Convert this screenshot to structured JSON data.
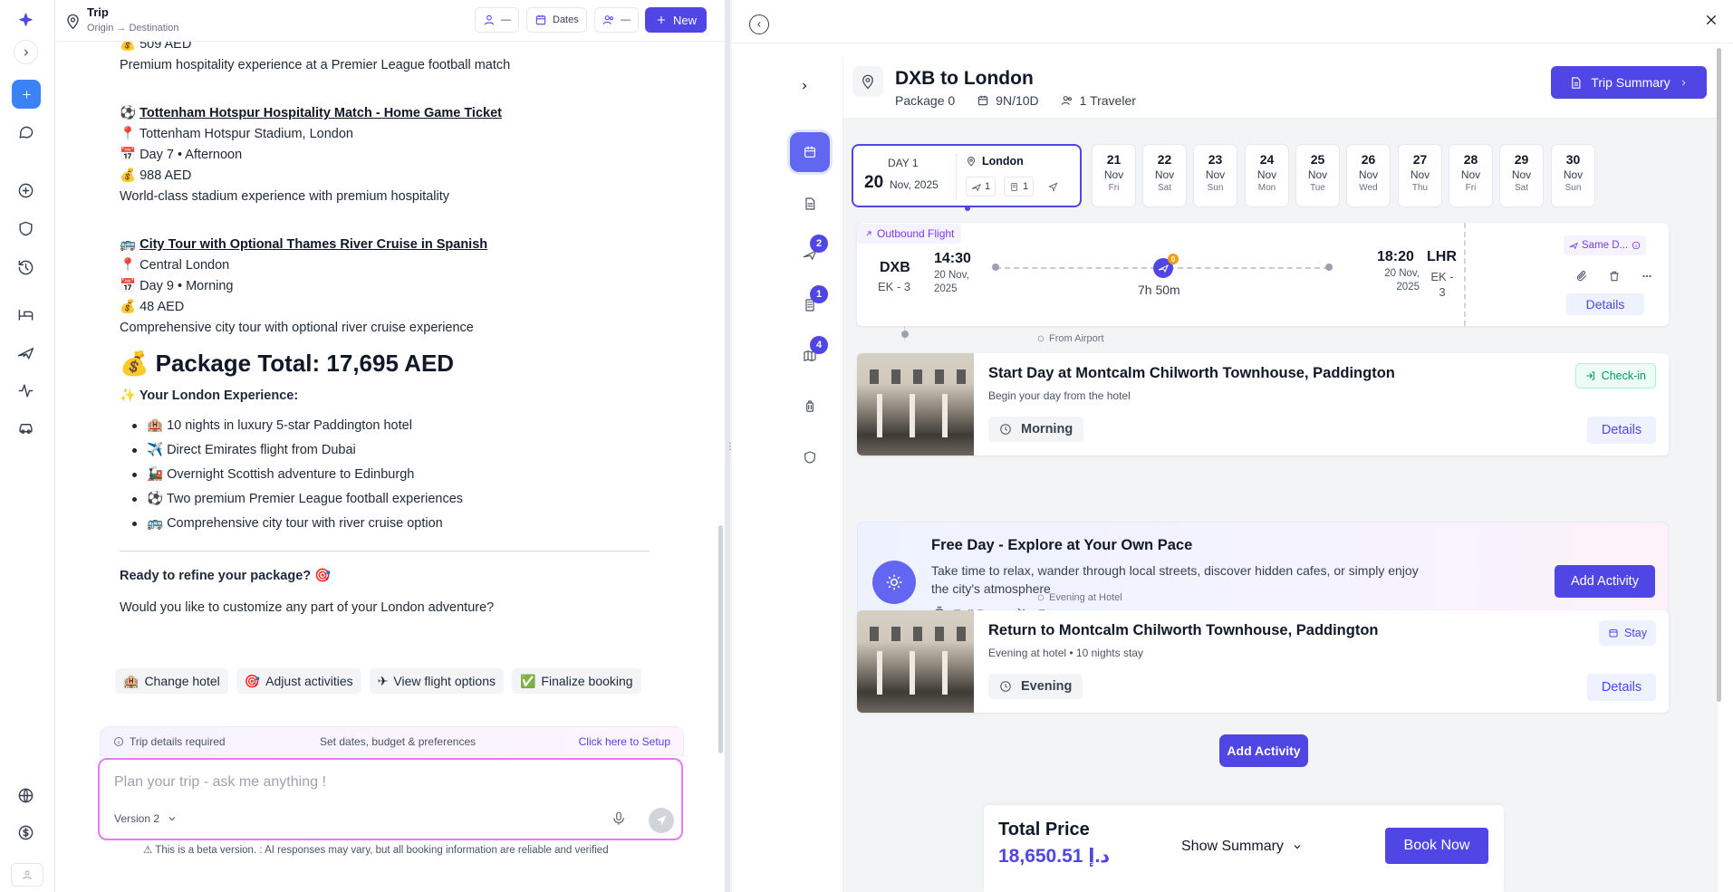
{
  "rail": {
    "icons": [
      "sparkle-logo-icon",
      "chevron-right-icon",
      "plus-icon",
      "chat-bubble-icon",
      "plus-circle-icon",
      "shield-icon",
      "history-icon",
      "bed-icon",
      "plane-icon",
      "activity-icon",
      "car-icon",
      "globe-icon",
      "dollar-icon",
      "user-icon"
    ]
  },
  "chat": {
    "header": {
      "title": "Trip",
      "subtitle": "Origin → Destination",
      "travelers_value": "—",
      "dates_label": "Dates",
      "group_value": "—",
      "new_label": "New"
    },
    "message": {
      "top_price": "💰 509 AED",
      "top_desc": "Premium hospitality experience at a Premier League football match",
      "items": [
        {
          "icon": "⚽",
          "title": "Tottenham Hotspur Hospitality Match - Home Game Ticket",
          "location": "📍 Tottenham Hotspur Stadium, London",
          "when": "📅 Day 7 • Afternoon",
          "price": "💰 988 AED",
          "desc": "World-class stadium experience with premium hospitality"
        },
        {
          "icon": "🚌",
          "title": "City Tour with Optional Thames River Cruise in Spanish",
          "location": "📍 Central London",
          "when": "📅 Day 9 • Morning",
          "price": "💰 48 AED",
          "desc": "Comprehensive city tour with optional river cruise experience"
        }
      ],
      "package_total": "💰 Package Total: 17,695 AED",
      "experience_heading": "✨ Your London Experience:",
      "bullets": [
        "🏨 10 nights in luxury 5-star Paddington hotel",
        "✈️ Direct Emirates flight from Dubai",
        "🚂 Overnight Scottish adventure to Edinburgh",
        "⚽ Two premium Premier League football experiences",
        "🚌 Comprehensive city tour with river cruise option"
      ],
      "ready": "Ready to refine your package? 🎯",
      "question": "Would you like to customize any part of your London adventure?"
    },
    "chips": [
      {
        "emoji": "🏨",
        "label": "Change hotel"
      },
      {
        "emoji": "🎯",
        "label": "Adjust activities"
      },
      {
        "emoji": "✈",
        "label": "View flight options"
      },
      {
        "emoji": "✅",
        "label": "Finalize booking"
      }
    ],
    "setup_bar": {
      "left": "Trip details required",
      "middle": "Set dates, budget & preferences",
      "link": "Click here to Setup"
    },
    "composer": {
      "placeholder": "Plan your trip - ask me anything !",
      "version": "Version 2"
    },
    "disclaimer": "⚠ This is a beta version. : AI responses may vary, but all booking information are reliable and verified"
  },
  "itinerary": {
    "title": "DXB to London",
    "package": "Package 0",
    "duration": "9N/10D",
    "travelers": "1 Traveler",
    "summary_button": "Trip Summary",
    "side_badges": {
      "flights": "2",
      "hotels": "1",
      "activities": "4"
    },
    "day_card": {
      "label": "DAY 1",
      "day_num": "20",
      "month_year": "Nov, 2025",
      "city": "London",
      "flights": "1",
      "hotels": "1"
    },
    "dates": [
      {
        "n": "21",
        "m": "Nov",
        "w": "Fri"
      },
      {
        "n": "22",
        "m": "Nov",
        "w": "Sat"
      },
      {
        "n": "23",
        "m": "Nov",
        "w": "Sun"
      },
      {
        "n": "24",
        "m": "Nov",
        "w": "Mon"
      },
      {
        "n": "25",
        "m": "Nov",
        "w": "Tue"
      },
      {
        "n": "26",
        "m": "Nov",
        "w": "Wed"
      },
      {
        "n": "27",
        "m": "Nov",
        "w": "Thu"
      },
      {
        "n": "28",
        "m": "Nov",
        "w": "Fri"
      },
      {
        "n": "29",
        "m": "Nov",
        "w": "Sat"
      },
      {
        "n": "30",
        "m": "Nov",
        "w": "Sun"
      }
    ],
    "flight": {
      "tag": "Outbound Flight",
      "from_code": "DXB",
      "from_flight": "EK - 3",
      "dep_time": "14:30",
      "dep_date": "20 Nov, 2025",
      "duration": "7h 50m",
      "stops": "0",
      "arr_time": "18:20",
      "arr_date": "20 Nov, 2025",
      "to_code": "LHR",
      "to_flight": "EK - 3",
      "same_day": "Same D...",
      "details": "Details"
    },
    "from_airport_label": "From Airport",
    "start_hotel": {
      "title": "Start Day at Montcalm Chilworth Townhouse, Paddington",
      "subtitle": "Begin your day from the hotel",
      "time": "Morning",
      "tag": "Check-in",
      "details": "Details"
    },
    "free_day": {
      "title": "Free Day - Explore at Your Own Pace",
      "desc": "Take time to relax, wander through local streets, discover hidden cafes, or simply enjoy the city's atmosphere",
      "duration": "Full Day",
      "cost": "Free",
      "button": "Add Activity"
    },
    "evening_label": "Evening at Hotel",
    "return_hotel": {
      "title": "Return to Montcalm Chilworth Townhouse, Paddington",
      "subtitle": "Evening at hotel • 10 nights stay",
      "time": "Evening",
      "tag": "Stay",
      "details": "Details"
    },
    "add_activity": "Add Activity",
    "total": {
      "label": "Total Price",
      "value": "18,650.51 د.إ",
      "show_summary": "Show Summary",
      "book": "Book Now"
    }
  }
}
